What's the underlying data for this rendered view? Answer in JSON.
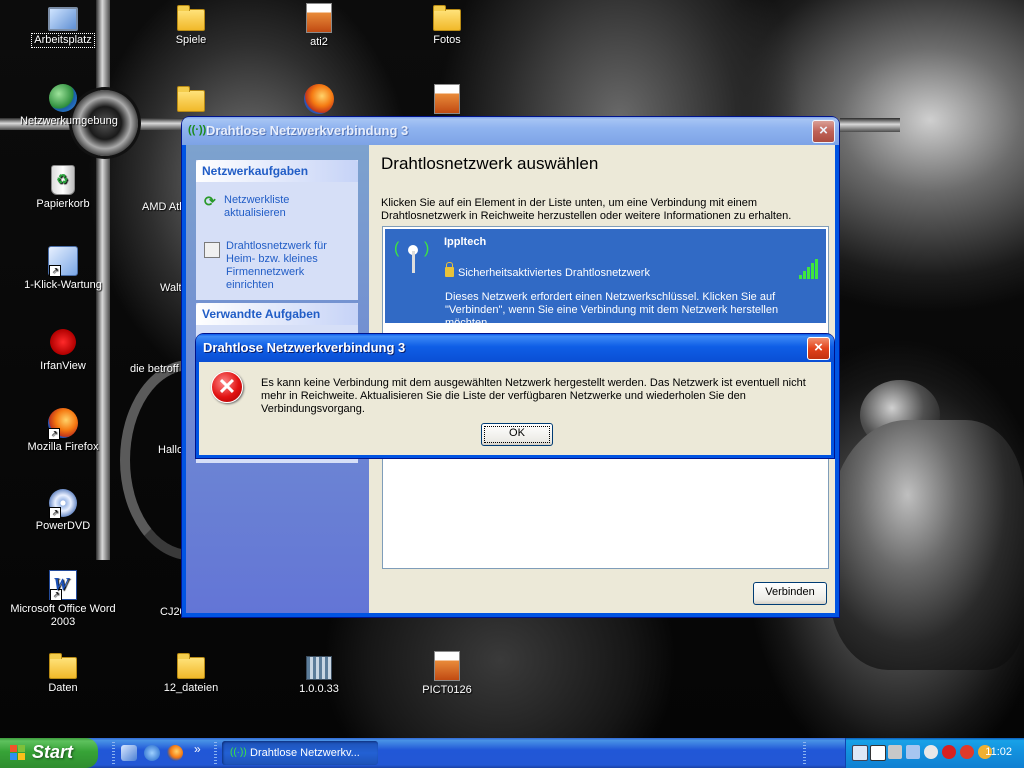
{
  "desktop": {
    "icons": [
      {
        "label": "Arbeitsplatz",
        "icon": "my-computer-icon"
      },
      {
        "label": "Spiele",
        "icon": "folder-icon"
      },
      {
        "label": "ati2",
        "icon": "image-file-icon"
      },
      {
        "label": "Fotos",
        "icon": "folder-icon"
      },
      {
        "label": "Netzwerkumgebung",
        "icon": "network-places-icon"
      },
      {
        "label": "Papierkorb",
        "icon": "recycle-bin-icon"
      },
      {
        "label": "AMD Ath",
        "icon": "shortcut-icon"
      },
      {
        "label": "1-Klick-Wartung",
        "icon": "maintenance-icon"
      },
      {
        "label": "Walt",
        "icon": "shortcut-icon"
      },
      {
        "label": "IrfanView",
        "icon": "irfanview-icon"
      },
      {
        "label": "die betroff",
        "icon": "shortcut-icon"
      },
      {
        "label": "Mozilla Firefox",
        "icon": "firefox-icon"
      },
      {
        "label": "Hallo",
        "icon": "shortcut-icon"
      },
      {
        "label": "PowerDVD",
        "icon": "powerdvd-icon"
      },
      {
        "label": "Microsoft Office Word 2003",
        "icon": "word-icon"
      },
      {
        "label": "CJ20",
        "icon": "shortcut-icon"
      },
      {
        "label": "Daten",
        "icon": "folder-icon"
      },
      {
        "label": "12_dateien",
        "icon": "folder-icon"
      },
      {
        "label": "1.0.0.33",
        "icon": "executable-icon"
      },
      {
        "label": "PICT0126",
        "icon": "image-file-icon"
      }
    ]
  },
  "main_window": {
    "title": "Drahtlose Netzwerkverbindung 3",
    "close_label": "×",
    "network_tasks": {
      "header": "Netzwerkaufgaben",
      "items": [
        {
          "label": "Netzwerkliste aktualisieren",
          "icon": "refresh-icon"
        },
        {
          "label": "Drahtlosnetzwerk für Heim- bzw. kleines Firmennetzwerk einrichten",
          "icon": "network-setup-icon"
        }
      ]
    },
    "related_tasks": {
      "header": "Verwandte Aufgaben"
    },
    "heading": "Drahtlosnetzwerk auswählen",
    "description": "Klicken Sie auf ein Element in der Liste unten, um eine Verbindung mit einem Drahtlosnetzwerk in Reichweite herzustellen oder weitere Informationen zu erhalten.",
    "networks": [
      {
        "ssid": "Ippltech",
        "security": "Sicherheitsaktiviertes Drahtlosnetzwerk",
        "description": "Dieses Netzwerk erfordert einen Netzwerkschlüssel. Klicken Sie auf \"Verbinden\", wenn Sie eine Verbindung mit dem Netzwerk herstellen möchten.",
        "signal_bars": 5,
        "signal_max": 5,
        "selected": true
      }
    ],
    "connect_label": "Verbinden"
  },
  "error_dialog": {
    "title": "Drahtlose Netzwerkverbindung 3",
    "close_label": "×",
    "icon_glyph": "✕",
    "message": "Es kann keine Verbindung mit dem ausgewählten Netzwerk hergestellt werden. Das Netzwerk ist eventuell nicht mehr in Reichweite. Aktualisieren Sie die Liste der verfügbaren Netzwerke und wiederholen Sie den Verbindungsvorgang.",
    "ok_label": "OK"
  },
  "taskbar": {
    "start_label": "Start",
    "quick_launch": [
      "show-desktop-icon",
      "internet-explorer-icon",
      "firefox-icon"
    ],
    "overflow_label": "»",
    "tasks": [
      {
        "label": "Drahtlose Netzwerkv...",
        "icon": "wireless-icon",
        "active": true
      }
    ],
    "clock": "11:02",
    "tray_icons": [
      "network-icon",
      "volume-icon",
      "app-icon",
      "security-icon",
      "wireless-tray-icon",
      "antivirus-icon",
      "update-icon",
      "sync-icon"
    ]
  },
  "colors": {
    "xp_blue": "#0054e3",
    "selection": "#316ac5",
    "dialog_face": "#ece9d8",
    "start_green": "#37a337"
  }
}
